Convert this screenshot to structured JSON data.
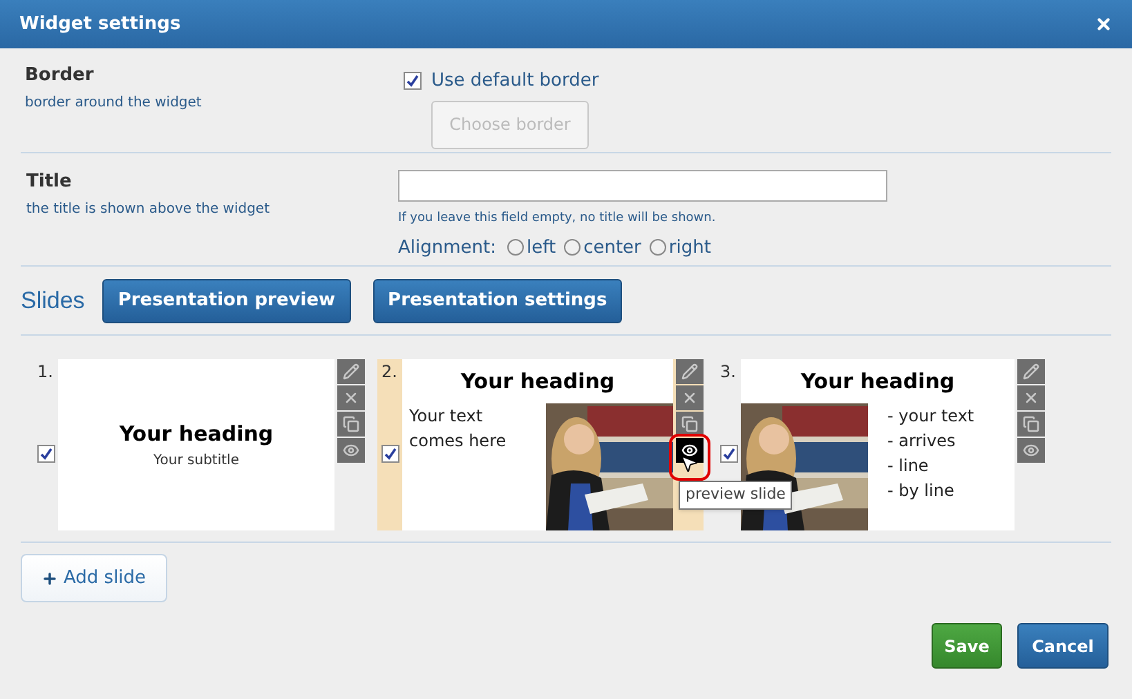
{
  "window": {
    "title": "Widget settings"
  },
  "border": {
    "label": "Border",
    "hint": "border around the widget",
    "use_default": {
      "label": "Use default border",
      "checked": true
    },
    "choose_button": {
      "label": "Choose border",
      "disabled": true
    }
  },
  "title": {
    "label": "Title",
    "hint": "the title is shown above the widget",
    "note": "If you leave this field empty, no title will be shown.",
    "alignment": {
      "label": "Alignment:",
      "options": [
        {
          "label": "left",
          "selected": false
        },
        {
          "label": "center",
          "selected": false
        },
        {
          "label": "right",
          "selected": false
        }
      ]
    }
  },
  "slides": {
    "heading": "Slides",
    "buttons": [
      "Presentation preview",
      "Presentation settings"
    ],
    "items": [
      {
        "number": "1.",
        "kind": "title",
        "checked": true,
        "selected": false,
        "heading": "Your heading",
        "subtitle": "Your subtitle"
      },
      {
        "number": "2.",
        "kind": "text-image",
        "checked": true,
        "selected": true,
        "heading": "Your heading",
        "text": "Your text comes here",
        "tooltip": "preview slide"
      },
      {
        "number": "3.",
        "kind": "image-list",
        "checked": true,
        "selected": false,
        "heading": "Your heading",
        "lines": [
          "- your text",
          "- arrives",
          "- line",
          "- by line"
        ]
      }
    ],
    "add_button": "Add slide"
  },
  "footer": {
    "save": "Save",
    "cancel": "Cancel"
  }
}
